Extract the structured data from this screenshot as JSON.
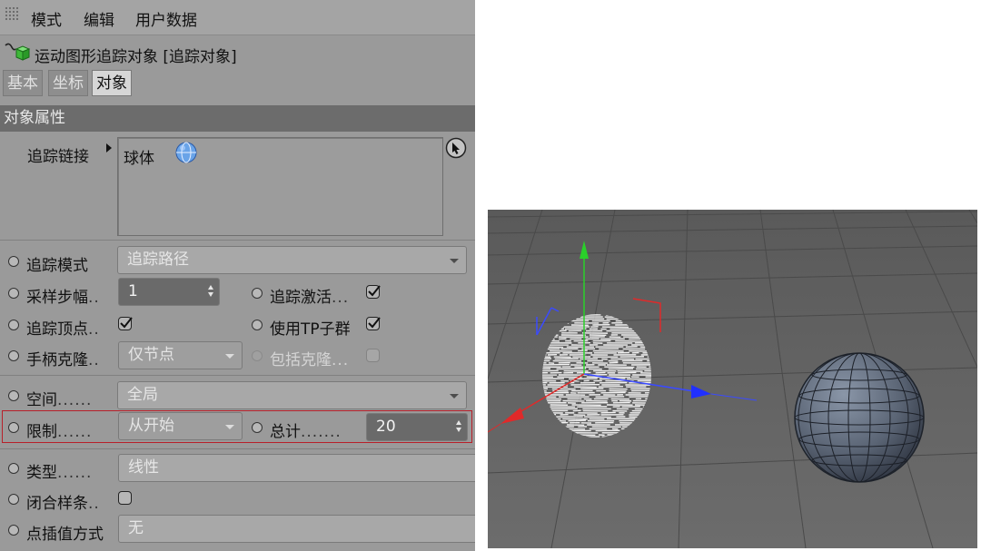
{
  "menu": {
    "mode": "模式",
    "edit": "编辑",
    "user_data": "用户数据"
  },
  "object_title": "运动图形追踪对象 [追踪对象]",
  "tabs": [
    {
      "label": "基本",
      "active": false
    },
    {
      "label": "坐标",
      "active": false
    },
    {
      "label": "对象",
      "active": true
    }
  ],
  "section_title": "对象属性",
  "trace_link": {
    "label": "追踪链接",
    "item": "球体"
  },
  "fields": {
    "trace_mode": {
      "label": "追踪模式",
      "value": "追踪路径"
    },
    "sample_step": {
      "label": "采样步幅",
      "dots": "..",
      "value": "1"
    },
    "trace_active": {
      "label": "追踪激活",
      "dots": "...",
      "checked": true
    },
    "trace_vertices": {
      "label": "追踪顶点",
      "dots": "..",
      "checked": true
    },
    "use_tp_groups": {
      "label": "使用TP子群",
      "checked": true
    },
    "handle_clone": {
      "label": "手柄克隆",
      "dots": "..",
      "value": "仅节点"
    },
    "include_clone": {
      "label": "包括克隆",
      "dots": "...",
      "checked": false
    },
    "space": {
      "label": "空间",
      "dots": "......",
      "value": "全局"
    },
    "limit": {
      "label": "限制",
      "dots": "......",
      "value": "从开始"
    },
    "total": {
      "label": "总计",
      "dots": ".......",
      "value": "20"
    },
    "type": {
      "label": "类型",
      "dots": "......",
      "value": "线性"
    },
    "close_spline": {
      "label": "闭合样条",
      "dots": "..",
      "checked": false
    },
    "interpolation": {
      "label": "点插值方式",
      "value": "无"
    }
  },
  "colors": {
    "highlight_border": "#b8202a",
    "panel_bg": "#9a9a9a",
    "section_bg": "#6c6c6c"
  }
}
